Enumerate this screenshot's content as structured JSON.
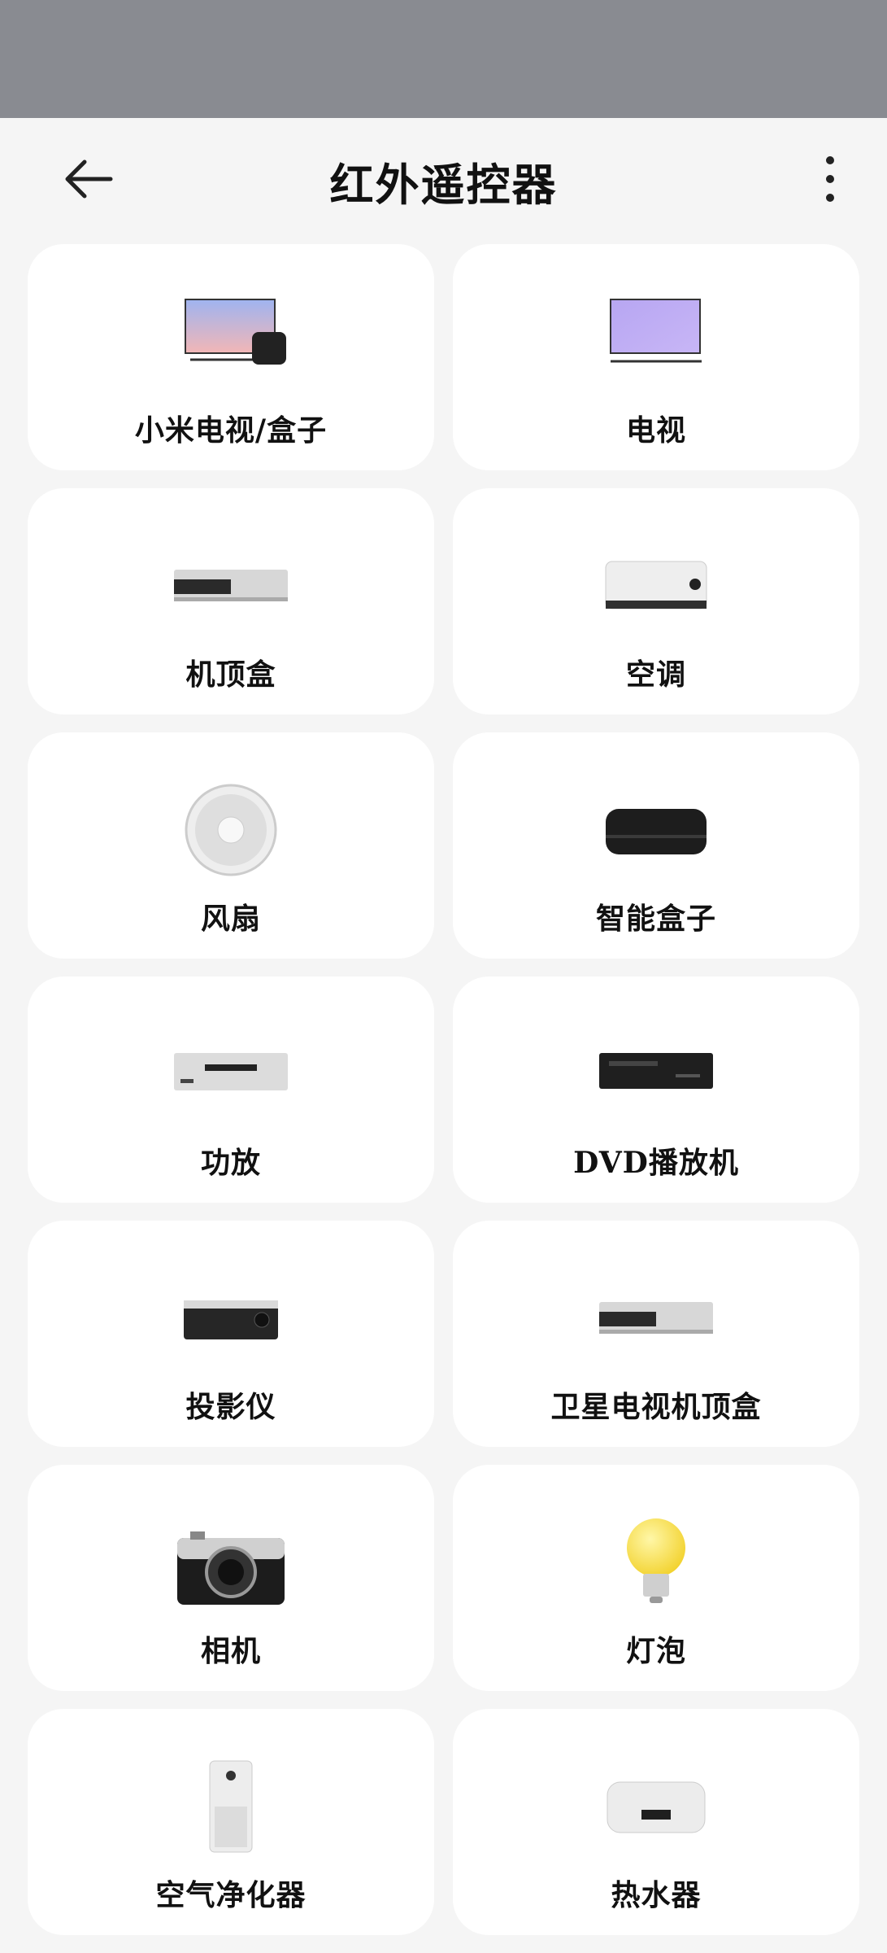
{
  "header": {
    "title": "红外遥控器"
  },
  "devices": [
    {
      "label": "小米电视/盒子",
      "icon": "tv-box-icon"
    },
    {
      "label": "电视",
      "icon": "tv-icon"
    },
    {
      "label": "机顶盒",
      "icon": "set-top-box-icon"
    },
    {
      "label": "空调",
      "icon": "air-conditioner-icon"
    },
    {
      "label": "风扇",
      "icon": "fan-icon"
    },
    {
      "label": "智能盒子",
      "icon": "smart-box-icon"
    },
    {
      "label": "功放",
      "icon": "amplifier-icon"
    },
    {
      "label": "DVD播放机",
      "icon": "dvd-player-icon"
    },
    {
      "label": "投影仪",
      "icon": "projector-icon"
    },
    {
      "label": "卫星电视机顶盒",
      "icon": "satellite-box-icon"
    },
    {
      "label": "相机",
      "icon": "camera-icon"
    },
    {
      "label": "灯泡",
      "icon": "light-bulb-icon"
    },
    {
      "label": "空气净化器",
      "icon": "air-purifier-icon"
    },
    {
      "label": "热水器",
      "icon": "water-heater-icon"
    }
  ],
  "colors": {
    "status_bar": "#898b91",
    "background": "#f5f5f5",
    "card": "#ffffff"
  }
}
